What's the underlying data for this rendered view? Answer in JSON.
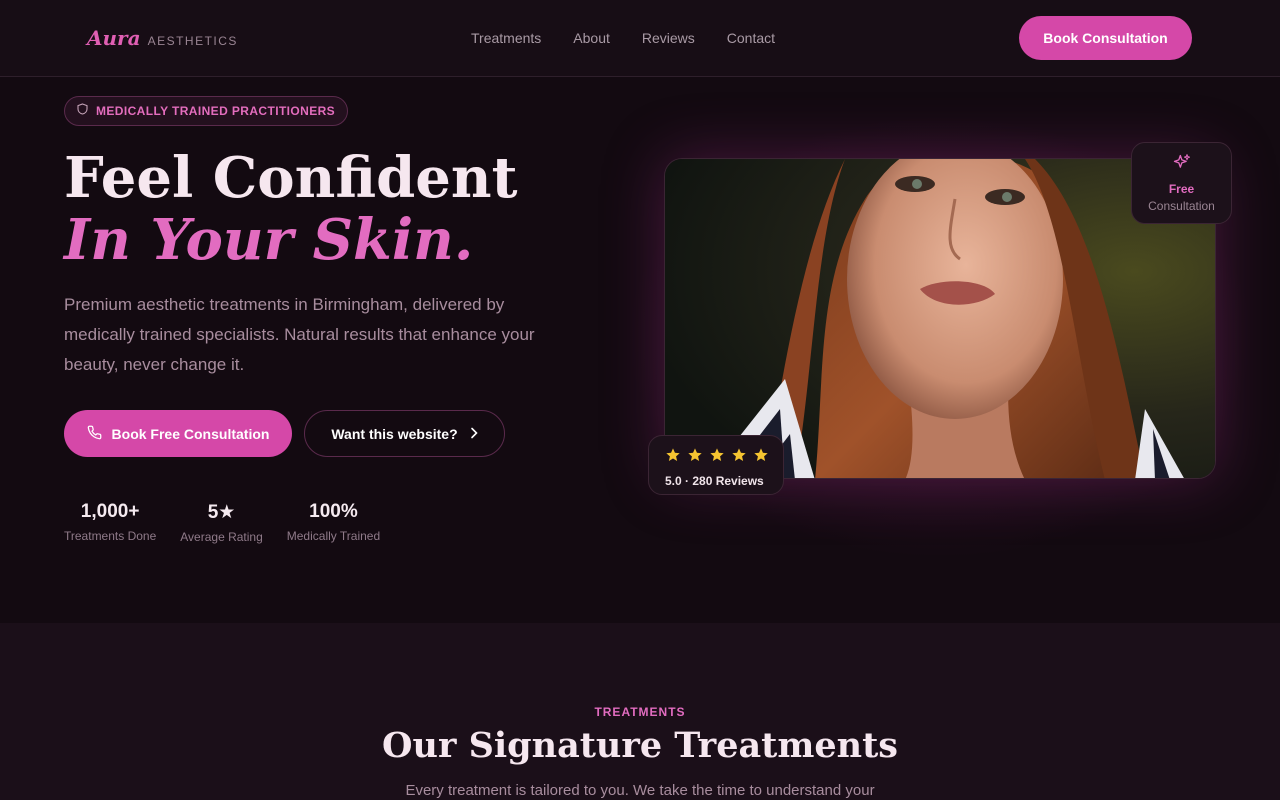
{
  "nav": {
    "logo_script": "Aura",
    "logo_sub": "AESTHETICS",
    "links": [
      "Treatments",
      "About",
      "Reviews",
      "Contact"
    ],
    "cta": "Book Consultation"
  },
  "hero": {
    "badge": "MEDICALLY TRAINED PRACTITIONERS",
    "headline_line1": "Feel Confident",
    "headline_line2": "In Your Skin.",
    "lede": "Premium aesthetic treatments in Birmingham, delivered by medically trained specialists. Natural results that enhance your beauty, never change it.",
    "primary_button": "Book Free Consultation",
    "secondary_button": "Want this website?",
    "stats": [
      {
        "value": "1,000+",
        "label": "Treatments Done"
      },
      {
        "value": "5★",
        "label": "Average Rating"
      },
      {
        "value": "100%",
        "label": "Medically Trained"
      }
    ],
    "float_card": {
      "title": "Free",
      "subtitle": "Consultation"
    },
    "rating_card": {
      "stars": 5,
      "text": "5.0 · 280 Reviews"
    }
  },
  "treatments": {
    "eyebrow": "TREATMENTS",
    "title": "Our Signature Treatments",
    "lede": "Every treatment is tailored to you. We take the time to understand your"
  },
  "colors": {
    "accent": "#d548a8",
    "accent_text": "#e26cc0",
    "background": "#130a11",
    "star": "#f6c531"
  }
}
